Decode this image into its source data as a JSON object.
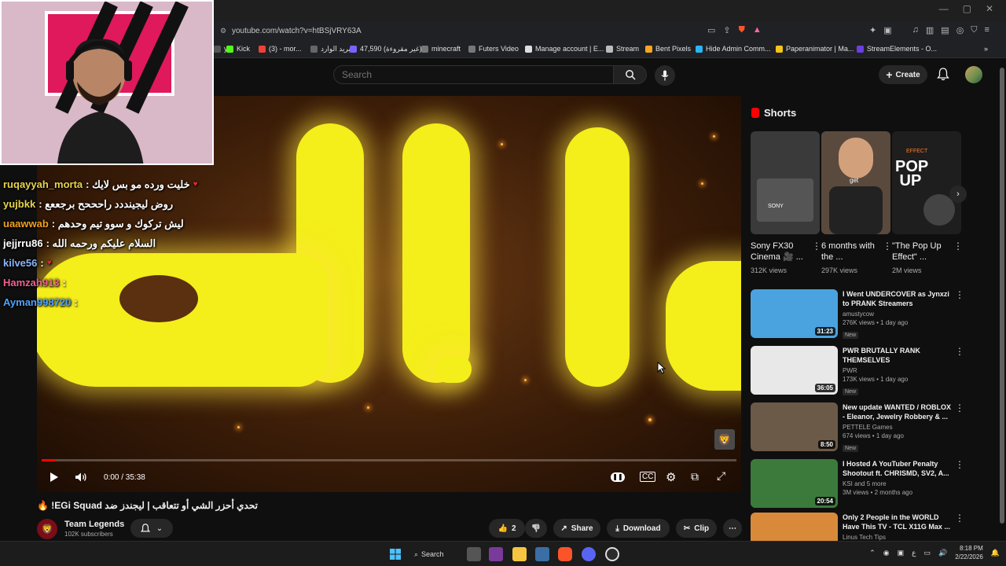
{
  "browser": {
    "url": "youtube.com/watch?v=htBSjVRY63A",
    "bookmarks": [
      {
        "label": "y",
        "color": "#555"
      },
      {
        "label": "Kick",
        "color": "#53fc18"
      },
      {
        "label": "(3) - mor...",
        "color": "#ea4335"
      },
      {
        "label": "البريد الوارد",
        "color": "#666"
      },
      {
        "label": "غير مقروءة) 47,590)...",
        "color": "#7b61ff"
      },
      {
        "label": "minecraft",
        "color": "#777"
      },
      {
        "label": "Futers Video",
        "color": "#777"
      },
      {
        "label": "Manage account | E...",
        "color": "#ddd"
      },
      {
        "label": "Stream",
        "color": "#bbb"
      },
      {
        "label": "Bent Pixels",
        "color": "#f6a623"
      },
      {
        "label": "Hide Admin Comm...",
        "color": "#29b6f6"
      },
      {
        "label": "Paperanimator | Ma...",
        "color": "#f5c518"
      },
      {
        "label": "StreamElements - O...",
        "color": "#6c3fe0"
      }
    ]
  },
  "header": {
    "search_placeholder": "Search",
    "create_label": "Create"
  },
  "player": {
    "time": "0:00 / 35:38",
    "progress_fraction": 0.02
  },
  "chat": [
    {
      "user": "ruqayyah_morta",
      "color": "#e8d44d",
      "msg": ": خليت ورده مو بس لايك",
      "heart": true
    },
    {
      "user": "yujbkk",
      "color": "#e8d44d",
      "msg": ": روض ليجينددد راحححح برجععع",
      "heart": false
    },
    {
      "user": "uaawwab",
      "color": "#f0a020",
      "msg": ": ليش تركوك و سوو تيم وحدهم",
      "heart": false
    },
    {
      "user": "jejjrru86",
      "color": "#ffffff",
      "msg": ": السلام عليكم ورحمه الله",
      "heart": false
    },
    {
      "user": "kilve56",
      "color": "#8ab4f8",
      "msg": ":",
      "heart": true
    },
    {
      "user": "Hamzah913",
      "color": "#f06292",
      "msg": ":",
      "heart": false
    },
    {
      "user": "Ayman998720",
      "color": "#4fa3ff",
      "msg": ":",
      "heart": false
    }
  ],
  "video": {
    "title": "تحدي أحزر الشي أو تتعاقب | ليجندز ضد EGi Squad! 🔥",
    "channel": "Team Legends",
    "subscribers": "102K subscribers",
    "likes": "2",
    "share": "Share",
    "download": "Download",
    "clip": "Clip"
  },
  "shorts": {
    "heading": "Shorts",
    "items": [
      {
        "title": "Sony FX30 Cinema 🎥 ...",
        "views": "312K views",
        "thumb_color": "#3a3a3a"
      },
      {
        "title": "6 months with the ...",
        "views": "297K views",
        "thumb_color": "#5a4a3e"
      },
      {
        "title": "\"The Pop Up Effect\" ...",
        "views": "2M views",
        "thumb_color": "#1e1e1e"
      }
    ]
  },
  "recommendations": [
    {
      "title": "I Went UNDERCOVER as Jynxzi to PRANK Streamers",
      "channel": "amustycow",
      "meta": "276K views • 1 day ago",
      "badge": "New",
      "duration": "31:23",
      "thumb_color": "#4aa3df"
    },
    {
      "title": "PWR BRUTALLY RANK THEMSELVES",
      "channel": "PWR",
      "meta": "173K views • 1 day ago",
      "badge": "New",
      "duration": "36:05",
      "thumb_color": "#e8e8e8"
    },
    {
      "title": "New update WANTED / ROBLOX - Eleanor, Jewelry Robbery & ...",
      "channel": "PETTELE Games",
      "meta": "674 views • 1 day ago",
      "badge": "New",
      "duration": "8:50",
      "thumb_color": "#6b5a48"
    },
    {
      "title": "I Hosted A YouTuber Penalty Shootout ft. CHRISMD, SV2, A...",
      "channel": "KSI and 5 more",
      "meta": "3M views • 2 months ago",
      "badge": "",
      "duration": "20:54",
      "thumb_color": "#3c7a3c"
    },
    {
      "title": "Only 2 People in the WORLD Have This TV - TCL X11G Max ...",
      "channel": "Linus Tech Tips",
      "meta": "",
      "badge": "",
      "duration": "",
      "thumb_color": "#d88a3a"
    }
  ],
  "taskbar": {
    "search_label": "Search",
    "time": "8:18 PM",
    "date": "2/22/2026"
  },
  "colors": {
    "accent_red": "#ff0000",
    "background": "#0f0f0f",
    "yellow_glyph": "#f4ee1a"
  }
}
